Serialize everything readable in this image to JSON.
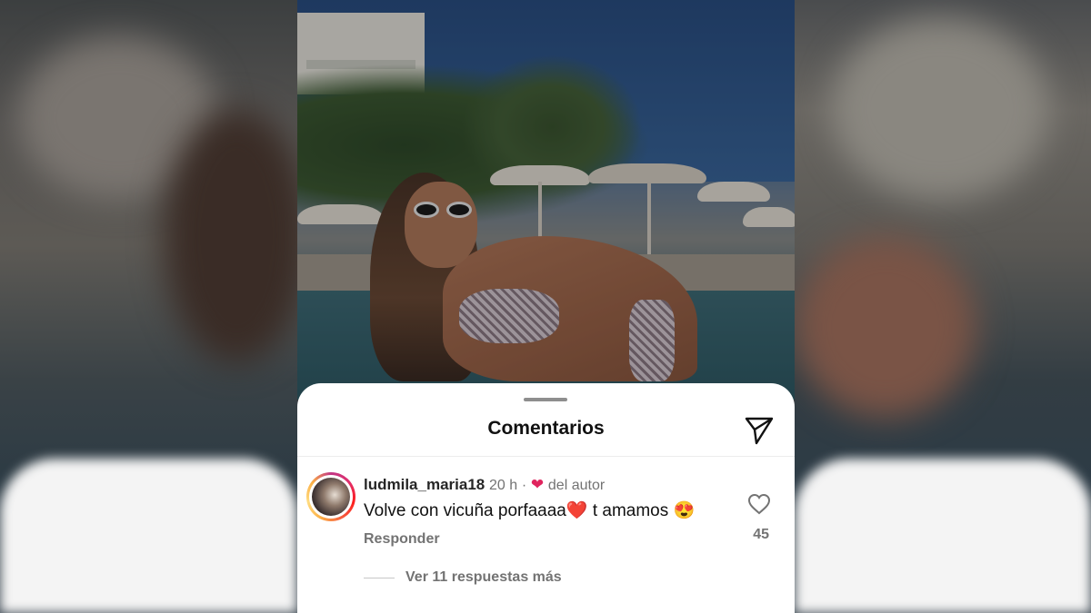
{
  "sheet": {
    "title": "Comentarios",
    "share_icon": "paper-plane-icon"
  },
  "comment": {
    "username": "ludmila_maria18",
    "time": "20 h",
    "separator": "·",
    "liked_by_author_icon": "heart-icon",
    "liked_by_author_label": "del autor",
    "text_part1": "Volve con vicuña porfaaaa",
    "text_emoji1": "❤️",
    "text_part2": " t amamos ",
    "text_emoji2": "😍",
    "reply_label": "Responder",
    "like_icon": "heart-outline-icon",
    "like_count": "45",
    "more_replies_label": "Ver 11 respuestas más"
  },
  "colors": {
    "accent_heart": "#e0245e",
    "secondary_text": "#737373",
    "primary_text": "#111111"
  }
}
